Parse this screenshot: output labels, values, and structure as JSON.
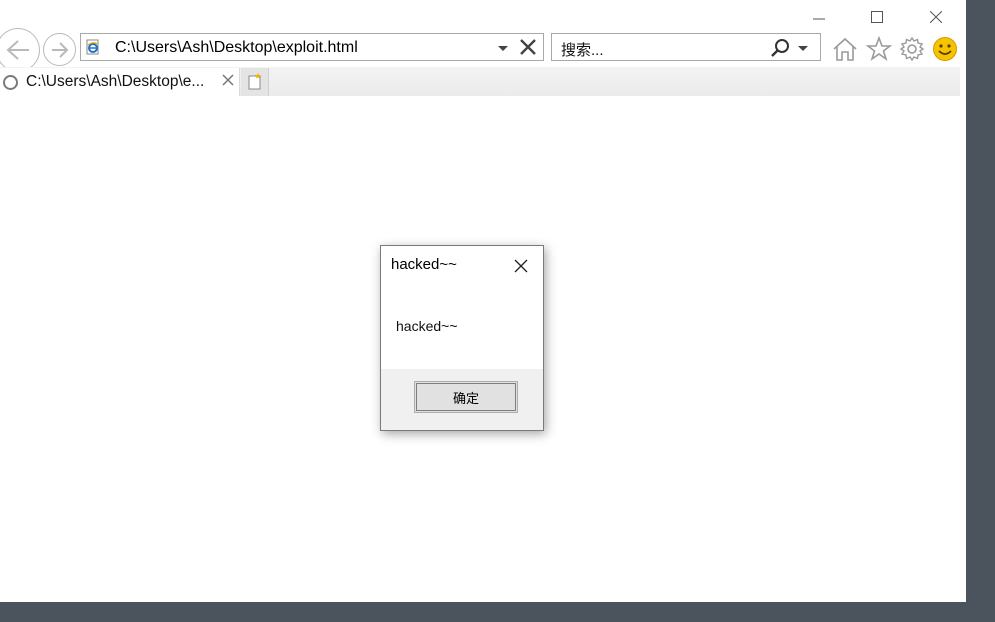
{
  "browser": {
    "address_url": "C:\\Users\\Ash\\Desktop\\exploit.html",
    "search_placeholder": "搜索...",
    "tab_title": "C:\\Users\\Ash\\Desktop\\e..."
  },
  "dialog": {
    "title": "hacked~~",
    "message": "hacked~~",
    "ok_label": "确定"
  },
  "icons": {
    "back": "back-arrow-icon",
    "forward": "forward-arrow-icon",
    "home": "home-icon",
    "favorites": "star-icon",
    "tools": "gear-icon",
    "feedback": "smiley-icon"
  },
  "colors": {
    "desktop": "#4b545c",
    "smiley": "#f5c400"
  }
}
